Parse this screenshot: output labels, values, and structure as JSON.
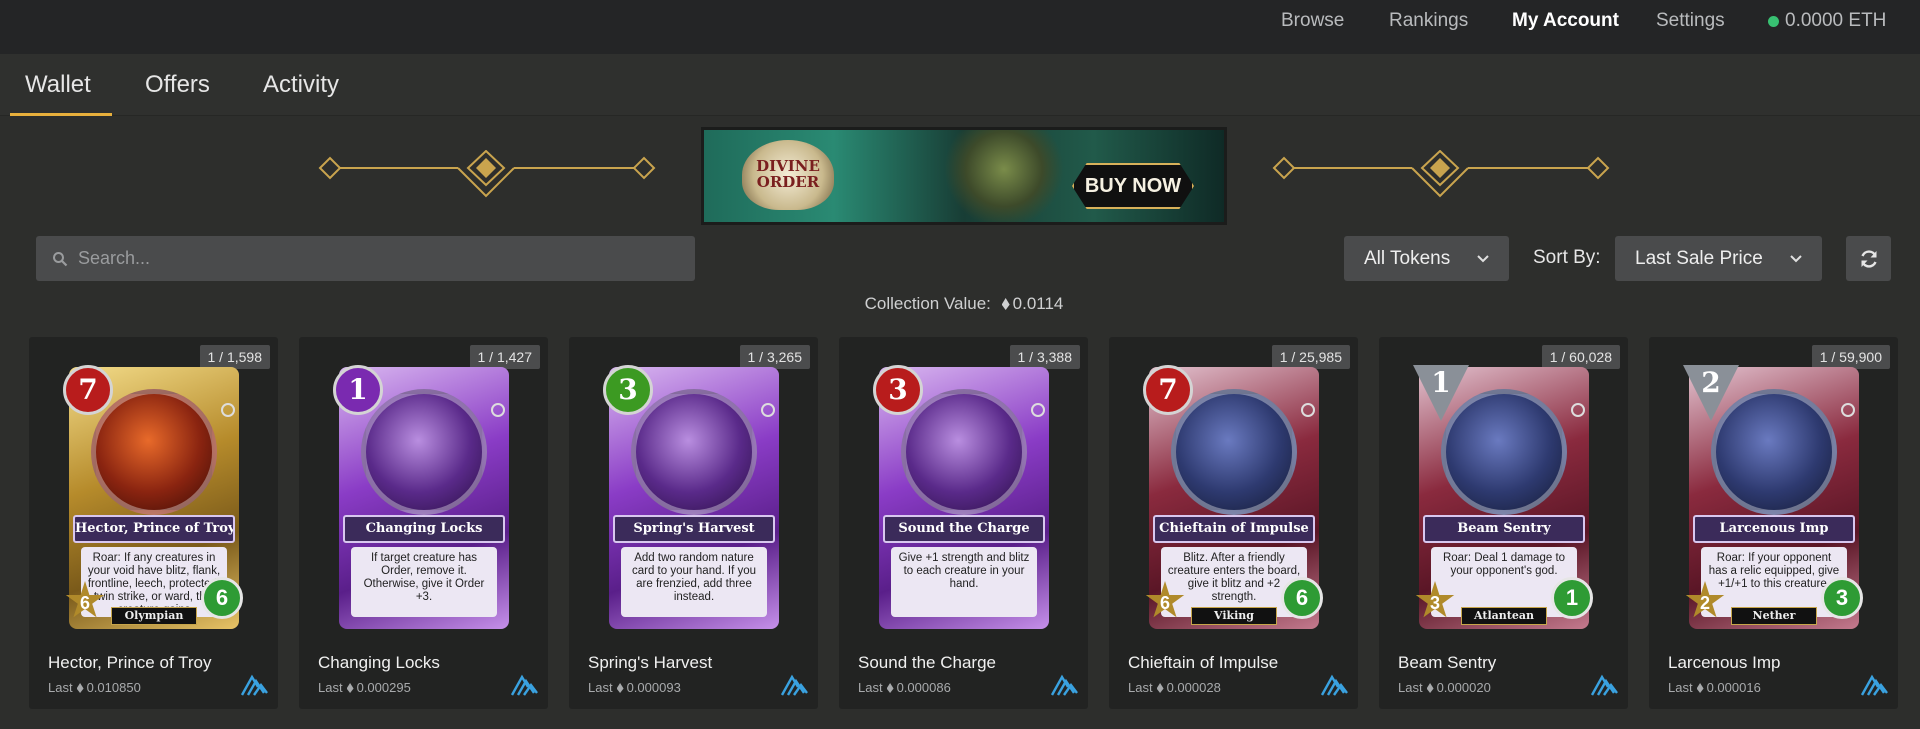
{
  "topnav": {
    "browse": "Browse",
    "rankings": "Rankings",
    "my_account": "My Account",
    "settings": "Settings",
    "balance": "0.0000 ETH"
  },
  "tabs": {
    "wallet": "Wallet",
    "offers": "Offers",
    "activity": "Activity",
    "active": "Wallet"
  },
  "banner": {
    "logo_text": "DIVINE ORDER",
    "cta": "BUY NOW"
  },
  "search": {
    "placeholder": "Search..."
  },
  "filter": {
    "tokens": "All Tokens",
    "sort_label": "Sort By:",
    "sort_value": "Last Sale Price"
  },
  "collection": {
    "label": "Collection Value:",
    "value": "0.0114"
  },
  "colors": {
    "accent": "#e8b03c",
    "online": "#38c172"
  },
  "cards": [
    {
      "supply": "1 / 1,598",
      "name": "Hector, Prince of Troy",
      "last_label": "Last",
      "last_price": "0.010850",
      "mana": "7",
      "attack": "6",
      "health": "6",
      "tribe": "Olympian",
      "text": "Roar: If any creatures in your void have blitz, flank, frontline, leech, protected, twin strike, or ward, this creature gains",
      "frame": "gold",
      "gem": "red"
    },
    {
      "supply": "1 / 1,427",
      "name": "Changing Locks",
      "last_label": "Last",
      "last_price": "0.000295",
      "mana": "1",
      "attack": "",
      "health": "",
      "tribe": "",
      "text": "If target creature has Order, remove it. Otherwise, give it Order +3.",
      "frame": "purple",
      "gem": "purple"
    },
    {
      "supply": "1 / 3,265",
      "name": "Spring's Harvest",
      "last_label": "Last",
      "last_price": "0.000093",
      "mana": "3",
      "attack": "",
      "health": "",
      "tribe": "",
      "text": "Add two random nature card to your hand. If you are frenzied, add three instead.",
      "frame": "purple",
      "gem": "green"
    },
    {
      "supply": "1 / 3,388",
      "name": "Sound the Charge",
      "last_label": "Last",
      "last_price": "0.000086",
      "mana": "3",
      "attack": "",
      "health": "",
      "tribe": "",
      "text": "Give +1 strength and blitz to each creature in your hand.",
      "frame": "purple",
      "gem": "red"
    },
    {
      "supply": "1 / 25,985",
      "name": "Chieftain of Impulse",
      "last_label": "Last",
      "last_price": "0.000028",
      "mana": "7",
      "attack": "6",
      "health": "6",
      "tribe": "Viking",
      "text": "Blitz. After a friendly creature enters the board, give it blitz and +2 strength.",
      "frame": "red",
      "gem": "red"
    },
    {
      "supply": "1 / 60,028",
      "name": "Beam Sentry",
      "last_label": "Last",
      "last_price": "0.000020",
      "mana": "1",
      "attack": "3",
      "health": "1",
      "tribe": "Atlantean",
      "text": "Roar: Deal 1 damage to your opponent's god.",
      "frame": "red",
      "gem": "grey"
    },
    {
      "supply": "1 / 59,900",
      "name": "Larcenous Imp",
      "last_label": "Last",
      "last_price": "0.000016",
      "mana": "2",
      "attack": "2",
      "health": "3",
      "tribe": "Nether",
      "text": "Roar: If your opponent has a relic equipped, give +1/+1 to this creature.",
      "frame": "red",
      "gem": "grey"
    }
  ]
}
